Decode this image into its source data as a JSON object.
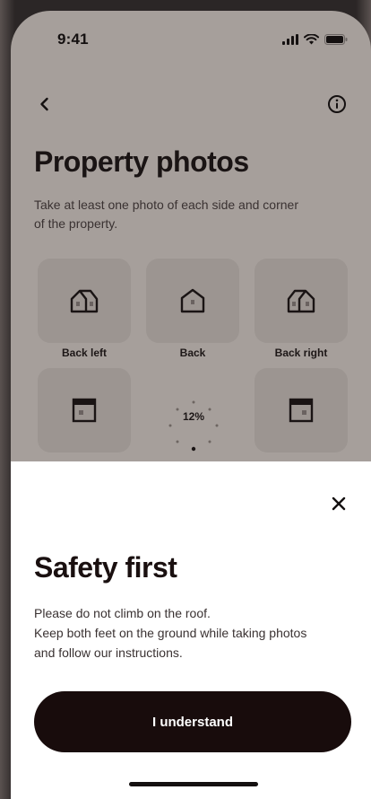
{
  "status_bar": {
    "time": "9:41"
  },
  "header": {
    "back_icon": "chevron-left-icon",
    "info_icon": "info-icon"
  },
  "page": {
    "title": "Property photos",
    "subtitle": "Take at least one photo of each side and corner of the property."
  },
  "tiles": [
    {
      "label": "Back left",
      "icon": "house-corner-icon"
    },
    {
      "label": "Back",
      "icon": "house-side-icon"
    },
    {
      "label": "Back right",
      "icon": "house-corner-icon"
    },
    {
      "label": "",
      "icon": "wall-icon"
    },
    {
      "label": "",
      "icon": "wall-icon"
    }
  ],
  "progress": {
    "text": "12%",
    "value": 0.12
  },
  "sheet": {
    "title": "Safety first",
    "lines": [
      "Please do not climb on the roof.",
      "Keep both feet on the ground while taking photos",
      "and follow our instructions."
    ],
    "button_label": "I understand",
    "close_icon": "close-icon"
  },
  "colors": {
    "dimmed_background": "#a69f9b",
    "tile_background": "#9c9591",
    "button_background": "#180c0c",
    "sheet_background": "#ffffff"
  }
}
